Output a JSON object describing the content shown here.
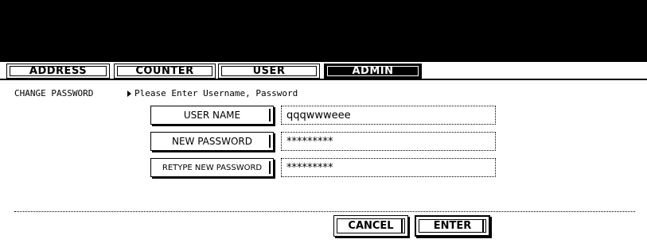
{
  "tabs": [
    {
      "label": "ADDRESS",
      "active": false
    },
    {
      "label": "COUNTER",
      "active": false
    },
    {
      "label": "USER",
      "active": false
    },
    {
      "label": "ADMIN",
      "active": true
    }
  ],
  "section": {
    "title": "CHANGE PASSWORD",
    "prompt": "Please Enter Username, Password"
  },
  "form": {
    "username_label": "USER NAME",
    "username_value": "qqqwwweee",
    "new_password_label": "NEW PASSWORD",
    "new_password_value": "*********",
    "retype_label": "RETYPE NEW PASSWORD",
    "retype_value": "*********"
  },
  "actions": {
    "cancel_label": "CANCEL",
    "enter_label": "ENTER"
  },
  "colors": {
    "header": "#000000",
    "background": "#ffffff"
  }
}
